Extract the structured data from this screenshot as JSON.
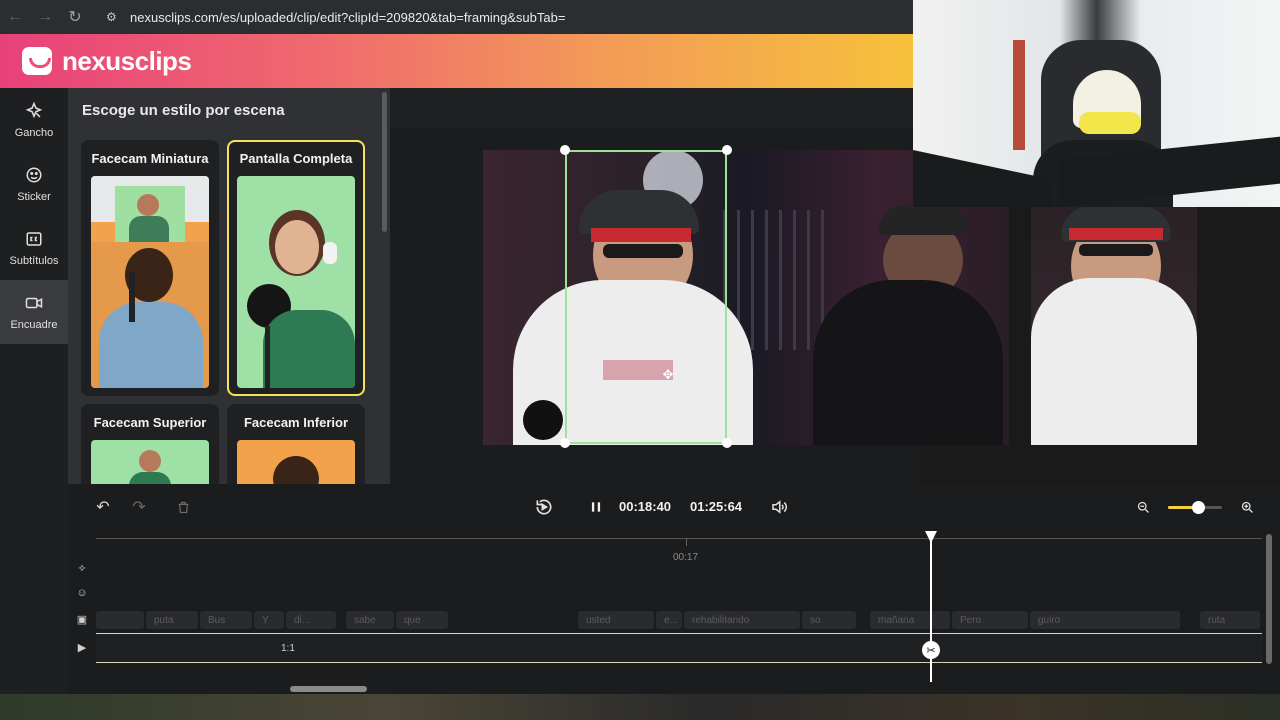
{
  "browser": {
    "url": "nexusclips.com/es/uploaded/clip/edit?clipId=209820&tab=framing&subTab="
  },
  "app": {
    "brand": "nexusclips"
  },
  "rail": {
    "items": [
      {
        "label": "Gancho",
        "icon": "hook-sparkle-icon"
      },
      {
        "label": "Sticker",
        "icon": "sticker-icon"
      },
      {
        "label": "Subtítulos",
        "icon": "captions-icon"
      },
      {
        "label": "Encuadre",
        "icon": "video-camera-icon",
        "active": true
      }
    ]
  },
  "panel": {
    "title": "Escoge un estilo por escena",
    "styles": [
      {
        "label": "Facecam Miniatura",
        "selected": false
      },
      {
        "label": "Pantalla Completa",
        "selected": true
      },
      {
        "label": "Facecam Superior",
        "selected": false
      },
      {
        "label": "Facecam Inferior",
        "selected": false
      }
    ]
  },
  "transport": {
    "current_time": "00:18:40",
    "total_time": "01:25:64",
    "zoom_level": 0.55
  },
  "timeline": {
    "ruler_label": "00:17",
    "clip_label": "1:1",
    "words": [
      "puta",
      "Bus",
      "Y",
      "di...",
      "sabe",
      "que",
      "usted",
      "e...",
      "rehabilitando",
      "so",
      "mañana",
      "Pero",
      "guiro",
      "ruta"
    ]
  },
  "colors": {
    "accent_yellow": "#f6e35a",
    "crop_green": "#9fe09a"
  }
}
